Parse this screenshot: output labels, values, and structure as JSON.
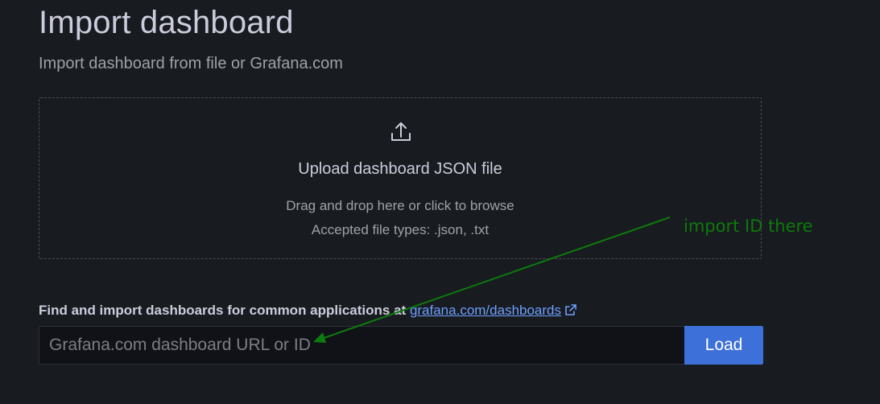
{
  "header": {
    "title": "Import dashboard",
    "subtitle": "Import dashboard from file or Grafana.com"
  },
  "upload": {
    "icon": "upload-icon",
    "title": "Upload dashboard JSON file",
    "hint": "Drag and drop here or click to browse",
    "accepted": "Accepted file types: .json, .txt"
  },
  "grafana_com": {
    "label": "Find and import dashboards for common applications at",
    "link_text": "grafana.com/dashboards",
    "link_icon": "external-link-icon",
    "input_placeholder": "Grafana.com dashboard URL or ID",
    "input_value": "",
    "load_label": "Load"
  },
  "annotation": {
    "text": "import ID there",
    "color": "#0d7a0d"
  },
  "colors": {
    "background": "#181b1f",
    "primary_button": "#3d71d9",
    "link": "#6e9fff"
  }
}
